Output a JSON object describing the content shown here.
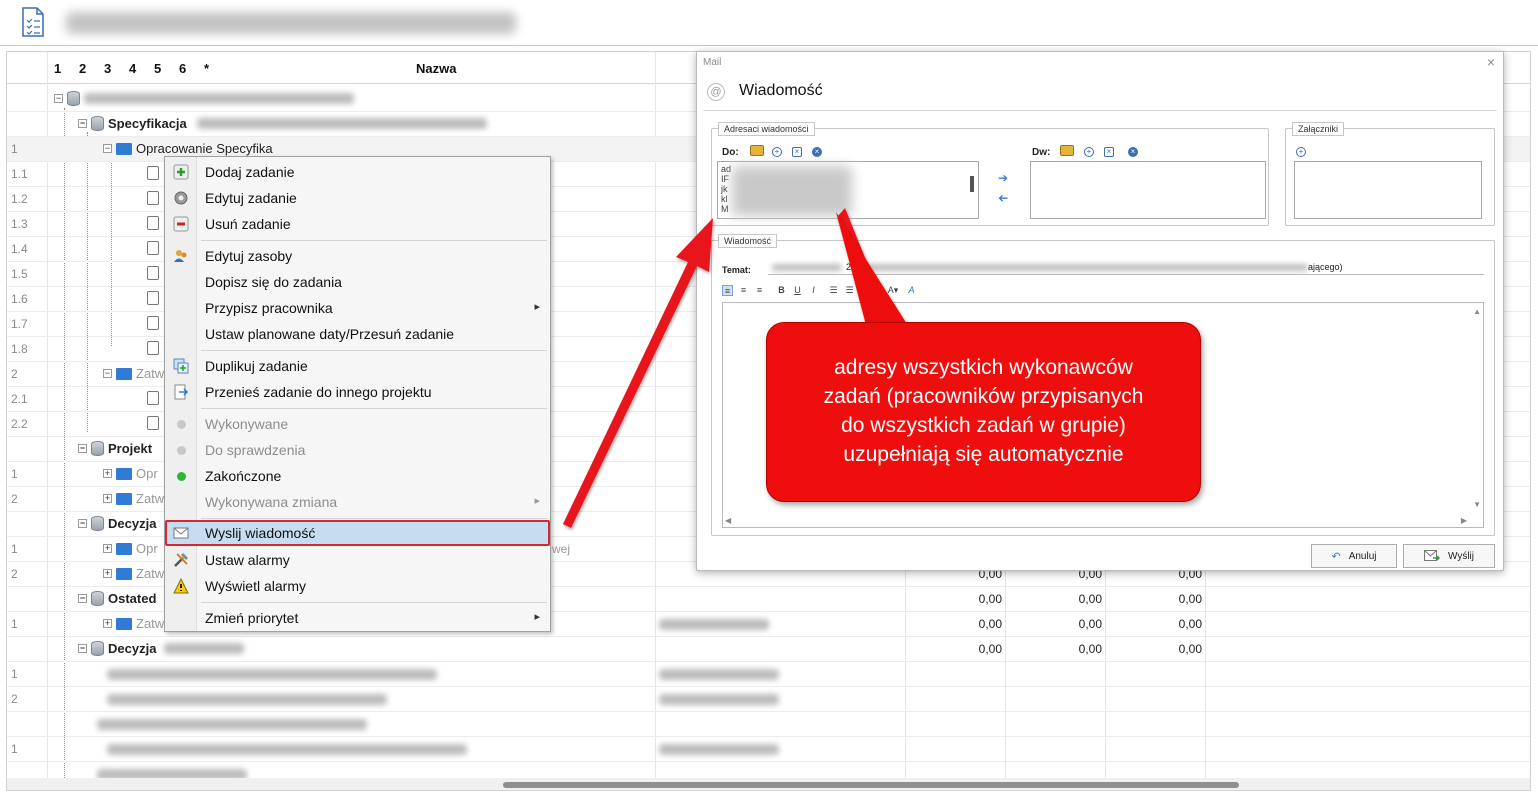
{
  "window": {
    "title_blurred": "GP-R-P-3824 - Sprężarka TG Hołowczyce -"
  },
  "grid": {
    "columns": [
      "1",
      "2",
      "3",
      "4",
      "5",
      "6",
      "*",
      "Nazwa"
    ],
    "rows": [
      {
        "num": "",
        "label": "",
        "blurred": true
      },
      {
        "num": "",
        "label": "Specyfikacja"
      },
      {
        "num": "1",
        "label": "Opracowanie Specyfika"
      },
      {
        "num": "1.1",
        "label": ""
      },
      {
        "num": "1.2",
        "label": ""
      },
      {
        "num": "1.3",
        "label": ""
      },
      {
        "num": "1.4",
        "label": ""
      },
      {
        "num": "1.5",
        "label": ""
      },
      {
        "num": "1.6",
        "label": ""
      },
      {
        "num": "1.7",
        "label": ""
      },
      {
        "num": "1.8",
        "label": ""
      },
      {
        "num": "2",
        "label": "Zatw"
      },
      {
        "num": "2.1",
        "label": ""
      },
      {
        "num": "2.2",
        "label": ""
      },
      {
        "num": "",
        "label": "Projekt"
      },
      {
        "num": "1",
        "label": "Opr"
      },
      {
        "num": "2",
        "label": "Zatw"
      },
      {
        "num": "",
        "label": "Decyzja"
      },
      {
        "num": "1",
        "label": "Opr",
        "extra": "wej"
      },
      {
        "num": "2",
        "label": "Zatw"
      },
      {
        "num": "",
        "label": "Ostated"
      },
      {
        "num": "1",
        "label": "Zatw"
      },
      {
        "num": "",
        "label": "Decyzja"
      },
      {
        "num": "1",
        "label": ""
      },
      {
        "num": "2",
        "label": ""
      },
      {
        "num": "",
        "label": ""
      },
      {
        "num": "1",
        "label": ""
      },
      {
        "num": "",
        "label": "Projekt budowlany"
      }
    ],
    "values_rows": [
      {
        "a": "0,00",
        "b": "0,00",
        "c": "0,00"
      },
      {
        "a": "0,00",
        "b": "0,00",
        "c": "0,00"
      },
      {
        "a": "0,00",
        "b": "0,00",
        "c": "0,00"
      },
      {
        "a": "0,00",
        "b": "0,00",
        "c": "0,00"
      }
    ]
  },
  "context_menu": {
    "items": [
      {
        "label": "Dodaj zadanie"
      },
      {
        "label": "Edytuj zadanie"
      },
      {
        "label": "Usuń zadanie"
      },
      {
        "label": "Edytuj zasoby"
      },
      {
        "label": "Dopisz się do zadania"
      },
      {
        "label": "Przypisz pracownika",
        "submenu": "▸"
      },
      {
        "label": "Ustaw planowane daty/Przesuń zadanie"
      },
      {
        "label": "Duplikuj zadanie"
      },
      {
        "label": "Przenieś zadanie do innego projektu"
      },
      {
        "label": "Wykonywane"
      },
      {
        "label": "Do sprawdzenia"
      },
      {
        "label": "Zakończone"
      },
      {
        "label": "Wykonywana zmiana",
        "submenu": "▸"
      },
      {
        "label": "Wyslij wiadomość"
      },
      {
        "label": "Ustaw alarmy"
      },
      {
        "label": "Wyświetl alarmy"
      },
      {
        "label": "Zmień priorytet",
        "submenu": "▸"
      }
    ]
  },
  "mail_dialog": {
    "window_title": "Mail",
    "close": "×",
    "heading": "Wiadomość",
    "recipients_legend": "Adresaci wiadomości",
    "to_label": "Do:",
    "cc_label": "Dw:",
    "to_lines": [
      "ad",
      "IF",
      "jk",
      "kl",
      "M"
    ],
    "attachments_legend": "Załączniki",
    "message_legend": "Wiadomość",
    "subject_label": "Temat:",
    "subject_fragment_1": "24",
    "subject_fragment_2": "p",
    "subject_fragment_3": "ającego)",
    "cancel_button": "Anuluj",
    "send_button": "Wyślij"
  },
  "callout": {
    "text_lines": [
      "adresy wszystkich wykonawców",
      "zadań (pracowników przypisanych",
      "do wszystkich zadań w grupie)",
      "uzupełniają się automatycznie"
    ],
    "color": "#ee0e0e"
  },
  "colors": {
    "highlight": "#c5dcf1",
    "highlight_border": "#d7282f",
    "accent_blue": "#2f7bd6",
    "arrow_red": "#e8171b"
  },
  "icons": {
    "document": "document-checklist-icon",
    "database": "database-icon",
    "folder": "folder-icon",
    "task": "clipboard-icon"
  }
}
